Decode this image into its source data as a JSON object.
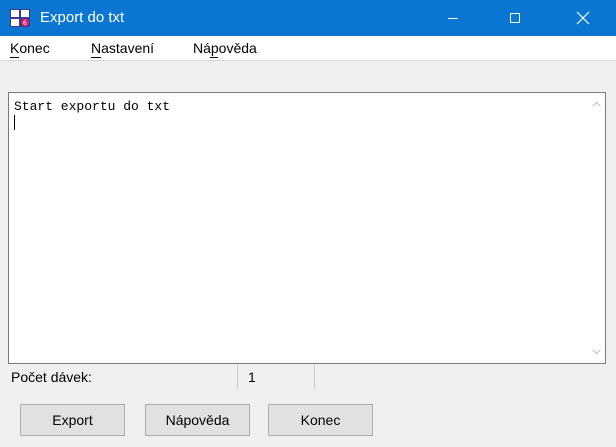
{
  "window": {
    "title": "Export do txt",
    "colors": {
      "titlebar": "#0a76d1",
      "title_text": "#ffffff"
    }
  },
  "menu": {
    "items": [
      {
        "label": "Konec",
        "mnemonic_index": 0
      },
      {
        "label": "Nastavení",
        "mnemonic_index": 0
      },
      {
        "label": "Nápověda",
        "mnemonic_index": 2
      }
    ]
  },
  "editor": {
    "text": "Start exportu do txt"
  },
  "status": {
    "label": "Počet dávek:",
    "value": "1"
  },
  "buttons": {
    "export": "Export",
    "help": "Nápověda",
    "close": "Konec"
  }
}
